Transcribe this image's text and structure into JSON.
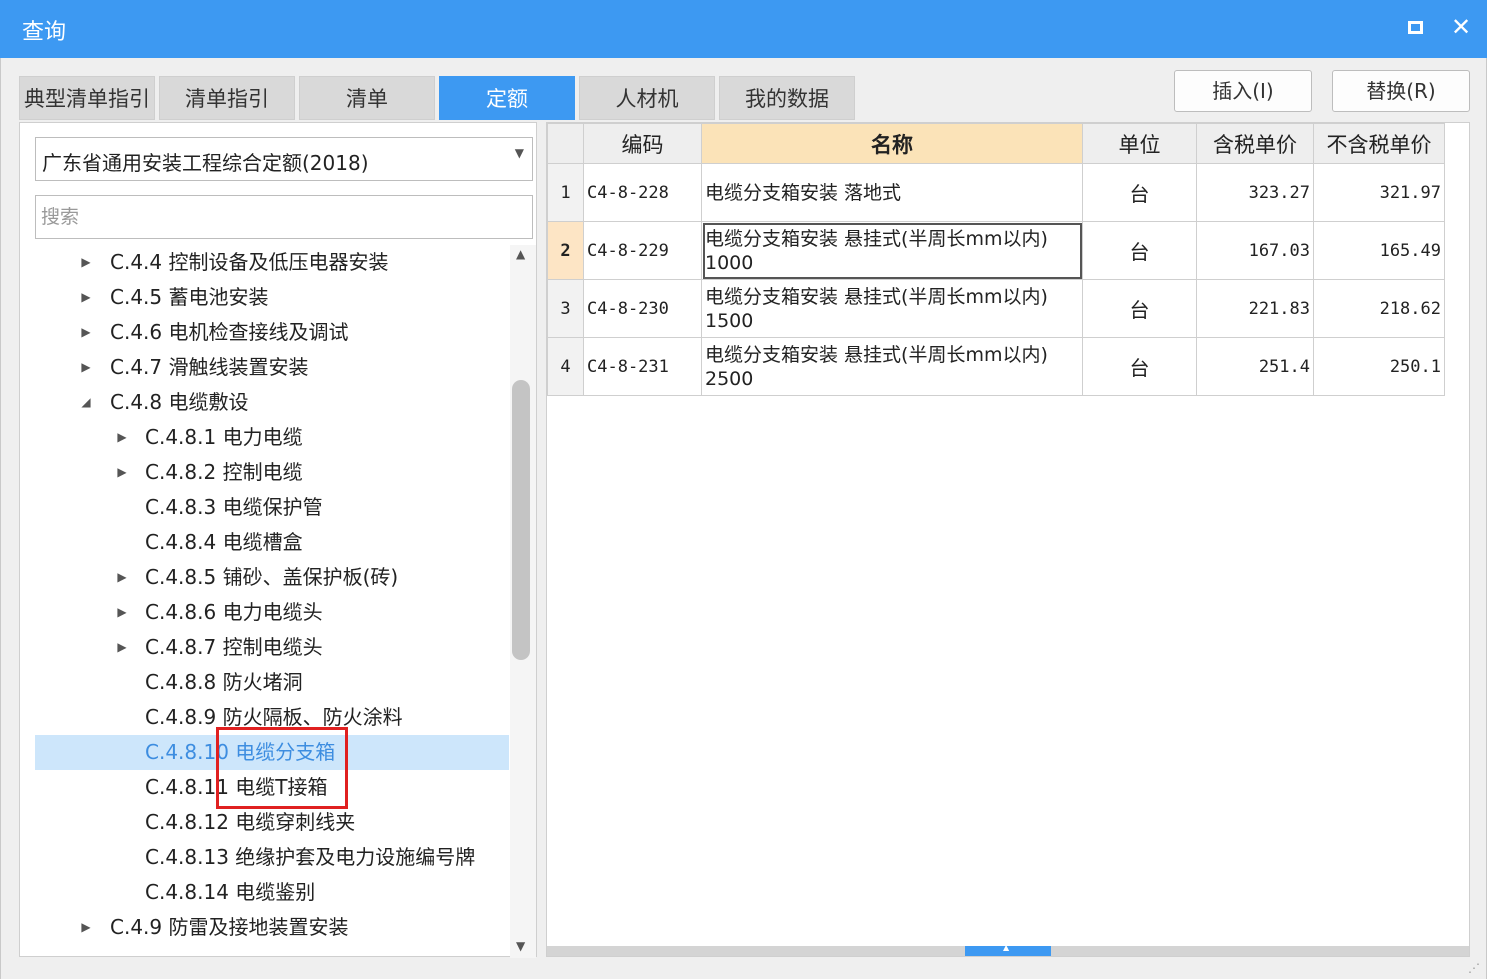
{
  "window": {
    "title": "查询",
    "maximize_icon": "maximize-icon",
    "close_label": "✕"
  },
  "tabs": [
    {
      "label": "典型清单指引",
      "active": false
    },
    {
      "label": "清单指引",
      "active": false
    },
    {
      "label": "清单",
      "active": false
    },
    {
      "label": "定额",
      "active": true
    },
    {
      "label": "人材机",
      "active": false
    },
    {
      "label": "我的数据",
      "active": false
    }
  ],
  "actions": {
    "insert_label": "插入(I)",
    "replace_label": "替换(R)"
  },
  "left": {
    "selector_value": "广东省通用安装工程综合定额(2018)",
    "search_placeholder": "搜索",
    "tree": [
      {
        "label": "C.4.4 控制设备及低压电器安装",
        "level": 1,
        "caret": "▶"
      },
      {
        "label": "C.4.5 蓄电池安装",
        "level": 1,
        "caret": "▶"
      },
      {
        "label": "C.4.6 电机检查接线及调试",
        "level": 1,
        "caret": "▶"
      },
      {
        "label": "C.4.7 滑触线装置安装",
        "level": 1,
        "caret": "▶"
      },
      {
        "label": "C.4.8 电缆敷设",
        "level": 1,
        "caret": "◢"
      },
      {
        "label": "C.4.8.1 电力电缆",
        "level": 2,
        "caret": "▶"
      },
      {
        "label": "C.4.8.2 控制电缆",
        "level": 2,
        "caret": "▶"
      },
      {
        "label": "C.4.8.3 电缆保护管",
        "level": 2,
        "caret": ""
      },
      {
        "label": "C.4.8.4 电缆槽盒",
        "level": 2,
        "caret": ""
      },
      {
        "label": "C.4.8.5 铺砂、盖保护板(砖)",
        "level": 2,
        "caret": "▶"
      },
      {
        "label": "C.4.8.6 电力电缆头",
        "level": 2,
        "caret": "▶"
      },
      {
        "label": "C.4.8.7 控制电缆头",
        "level": 2,
        "caret": "▶"
      },
      {
        "label": "C.4.8.8 防火堵洞",
        "level": 2,
        "caret": ""
      },
      {
        "label": "C.4.8.9 防火隔板、防火涂料",
        "level": 2,
        "caret": ""
      },
      {
        "label": "C.4.8.10 电缆分支箱",
        "level": 2,
        "caret": "",
        "selected": true
      },
      {
        "label": "C.4.8.11 电缆T接箱",
        "level": 2,
        "caret": ""
      },
      {
        "label": "C.4.8.12 电缆穿刺线夹",
        "level": 2,
        "caret": ""
      },
      {
        "label": "C.4.8.13 绝缘护套及电力设施编号牌",
        "level": 2,
        "caret": ""
      },
      {
        "label": "C.4.8.14 电缆鉴别",
        "level": 2,
        "caret": ""
      },
      {
        "label": "C.4.9 防雷及接地装置安装",
        "level": 1,
        "caret": "▶"
      }
    ],
    "scroll_up": "▲",
    "scroll_down": "▼"
  },
  "grid": {
    "columns": [
      "",
      "编码",
      "名称",
      "单位",
      "含税单价",
      "不含税单价"
    ],
    "rows": [
      {
        "n": "1",
        "code": "C4-8-228",
        "name": "电缆分支箱安装 落地式",
        "unit": "台",
        "tax_price": "323.27",
        "notax_price": "321.97"
      },
      {
        "n": "2",
        "code": "C4-8-229",
        "name": "电缆分支箱安装 悬挂式(半周长mm以内) 1000",
        "unit": "台",
        "tax_price": "167.03",
        "notax_price": "165.49"
      },
      {
        "n": "3",
        "code": "C4-8-230",
        "name": "电缆分支箱安装 悬挂式(半周长mm以内) 1500",
        "unit": "台",
        "tax_price": "221.83",
        "notax_price": "218.62"
      },
      {
        "n": "4",
        "code": "C4-8-231",
        "name": "电缆分支箱安装 悬挂式(半周长mm以内) 2500",
        "unit": "台",
        "tax_price": "251.4",
        "notax_price": "250.1"
      }
    ],
    "current_row": 1
  },
  "colors": {
    "accent": "#3d99f2",
    "highlight": "#e02020",
    "sorted_header": "#fbe3b8"
  }
}
